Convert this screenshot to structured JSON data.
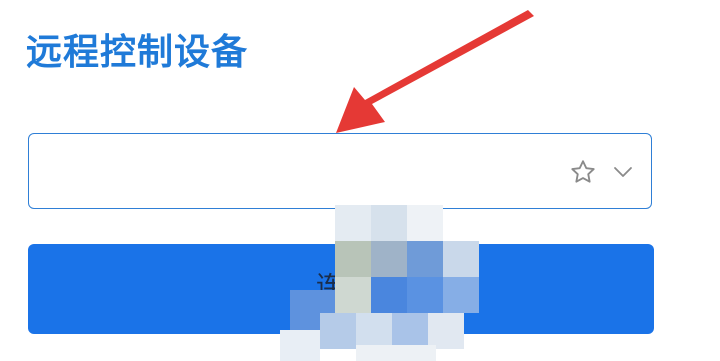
{
  "panel": {
    "title": "远程控制设备"
  },
  "device_input": {
    "value": "",
    "placeholder": ""
  },
  "icons": {
    "favorite": "star-icon",
    "dropdown": "chevron-down-icon"
  },
  "connect_button": {
    "label": "连接"
  },
  "colors": {
    "title": "#1f7ad8",
    "input_border": "#2f7fd6",
    "button": "#1a73e8",
    "arrow": "#e53935"
  }
}
